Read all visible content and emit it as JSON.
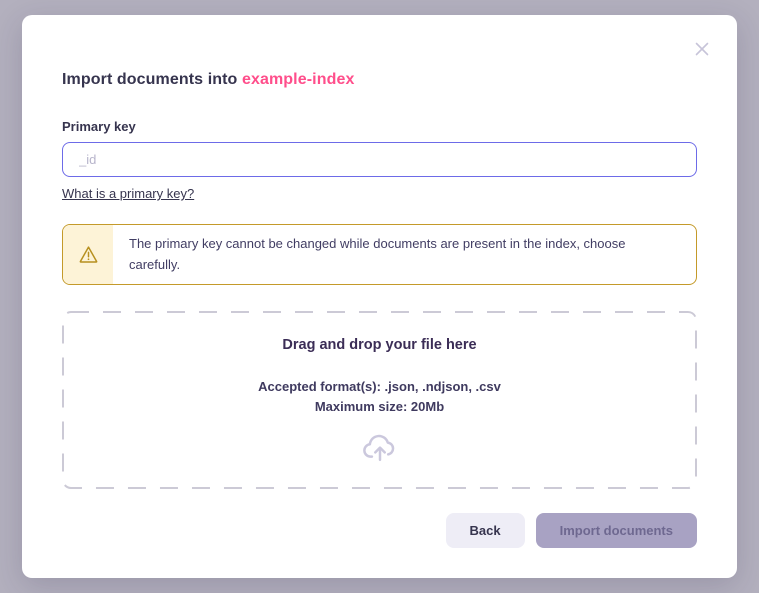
{
  "modal": {
    "title_prefix": "Import documents into ",
    "index_name": "example-index"
  },
  "form": {
    "primary_key_label": "Primary key",
    "primary_key_placeholder": "_id",
    "primary_key_value": "",
    "help_link_label": "What is a primary key?"
  },
  "warning": {
    "text": "The primary key cannot be changed while documents are present in the index, choose carefully."
  },
  "dropzone": {
    "title": "Drag and drop your file here",
    "formats": "Accepted format(s): .json, .ndjson, .csv",
    "max_size": "Maximum size: 20Mb"
  },
  "actions": {
    "back_label": "Back",
    "import_label": "Import documents"
  },
  "colors": {
    "backdrop": "#b3b0be",
    "accent_pink": "#ff4e8b",
    "input_border": "#6d6be8",
    "warning_border": "#c49a2a",
    "warning_icon": "#b7901f",
    "warning_strip_bg": "#fdf3d7",
    "dash_border": "#cccad6",
    "cloud_icon": "#cbc8dd",
    "back_button_bg": "#eeedf6",
    "import_button_bg": "#a8a2c3",
    "import_button_text": "#6e6890",
    "text_dark": "#36344e"
  }
}
